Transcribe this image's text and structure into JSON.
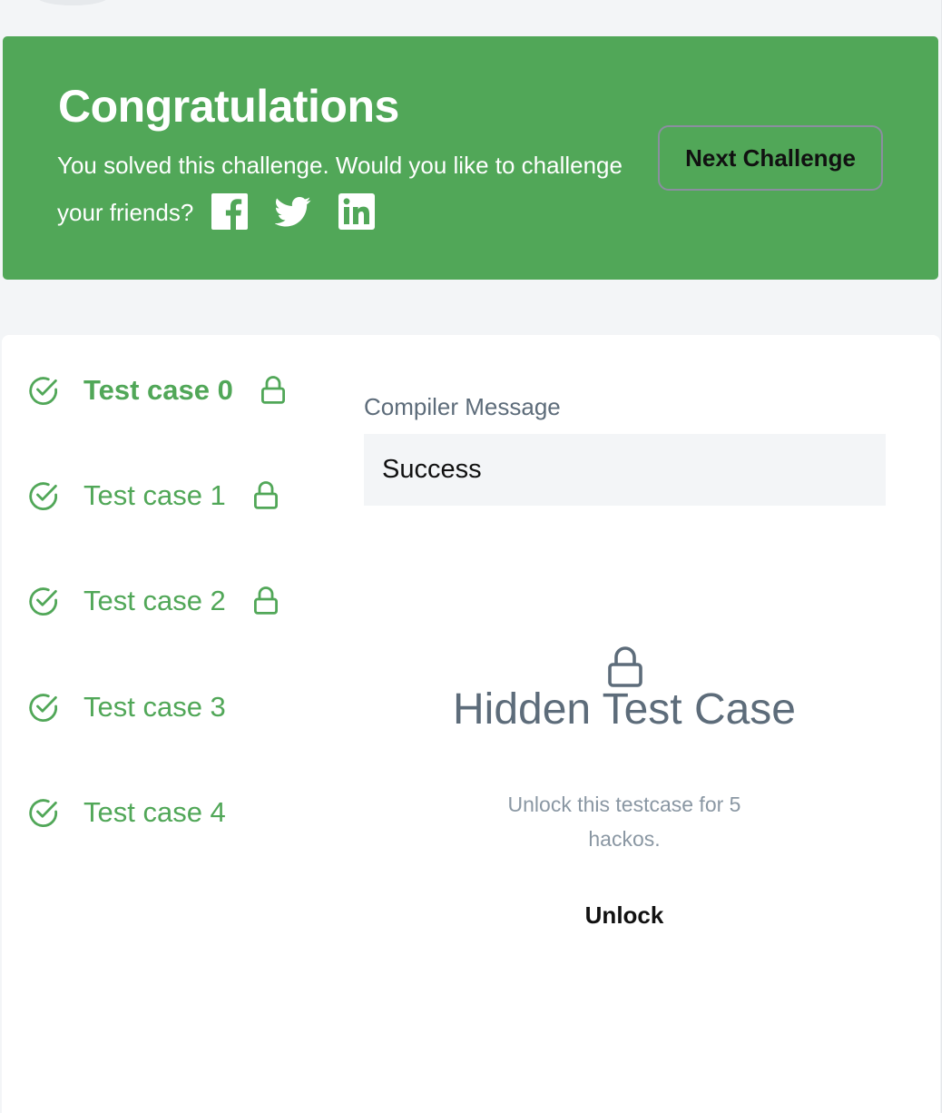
{
  "banner": {
    "title": "Congratulations",
    "message": "You solved this challenge. Would you like to challenge your friends?",
    "next_button": "Next Challenge",
    "social": [
      "facebook-icon",
      "twitter-icon",
      "linkedin-icon"
    ],
    "bg_color": "#51a758"
  },
  "test_cases": [
    {
      "label": "Test case 0",
      "status": "passed",
      "locked": true,
      "active": true
    },
    {
      "label": "Test case 1",
      "status": "passed",
      "locked": true,
      "active": false
    },
    {
      "label": "Test case 2",
      "status": "passed",
      "locked": true,
      "active": false
    },
    {
      "label": "Test case 3",
      "status": "passed",
      "locked": false,
      "active": false
    },
    {
      "label": "Test case 4",
      "status": "passed",
      "locked": false,
      "active": false
    }
  ],
  "compiler": {
    "label": "Compiler Message",
    "value": "Success"
  },
  "hidden": {
    "title": "Hidden Test Case",
    "description": "Unlock this testcase for 5 hackos.",
    "unlock_button": "Unlock"
  },
  "colors": {
    "success": "#51a758",
    "muted": "#5d6c7a"
  }
}
